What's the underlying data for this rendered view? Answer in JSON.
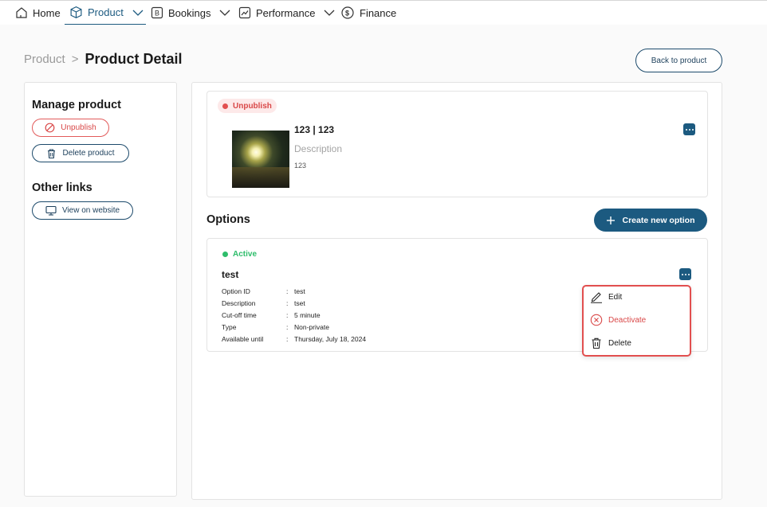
{
  "nav": {
    "items": [
      {
        "label": "Home",
        "icon": "home-icon"
      },
      {
        "label": "Product",
        "icon": "cube-icon",
        "active": true
      },
      {
        "label": "Bookings",
        "icon": "bookings-icon"
      },
      {
        "label": "Performance",
        "icon": "trend-icon"
      },
      {
        "label": "Finance",
        "icon": "dollar-cycle-icon"
      }
    ]
  },
  "breadcrumb": {
    "parent": "Product",
    "separator": ">",
    "current": "Product Detail"
  },
  "header": {
    "back_label": "Back to product"
  },
  "sidebar": {
    "manage_title": "Manage product",
    "unpublish_label": "Unpublish",
    "delete_label": "Delete product",
    "links_title": "Other links",
    "view_label": "View on website"
  },
  "product": {
    "status": "Unpublish",
    "name": "123 | 123",
    "description_label": "Description",
    "description": "123"
  },
  "options": {
    "title": "Options",
    "create_label": "Create new option",
    "item": {
      "status": "Active",
      "name": "test",
      "rows": [
        {
          "key": "Option ID",
          "value": "test"
        },
        {
          "key": "Description",
          "value": "tset"
        },
        {
          "key": "Cut-off time",
          "value": "5 minute"
        },
        {
          "key": "Type",
          "value": "Non-private"
        },
        {
          "key": "Available until",
          "value": "Thursday, July 18, 2024"
        }
      ]
    }
  },
  "menu": {
    "edit": "Edit",
    "deactivate": "Deactivate",
    "delete": "Delete"
  },
  "colors": {
    "primary": "#1c5a80",
    "danger": "#d94848",
    "success": "#2ebd6b"
  }
}
